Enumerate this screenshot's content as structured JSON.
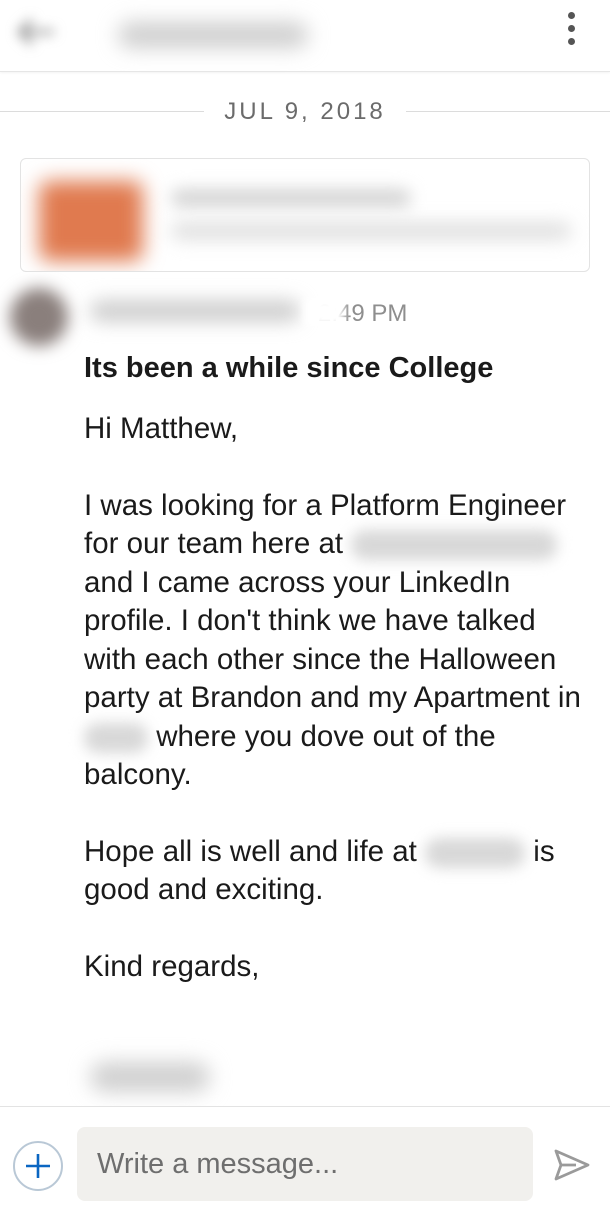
{
  "header": {
    "back_icon": "arrow-left-icon",
    "menu_icon": "more-vert-icon"
  },
  "date_divider": "JUL 9, 2018",
  "message": {
    "time": "2:49 PM",
    "subject": "Its been a while since College",
    "greeting": "Hi Matthew,",
    "body_part1": "I was looking for a Platform Engineer for our team here at",
    "body_part2": "and I came across your LinkedIn profile. I don't think we have talked with each other since the Halloween party at Brandon and my Apartment in",
    "body_part3": "where you dove out of the balcony.",
    "hope_part1": "Hope all is well and life at",
    "hope_part2": "is good and exciting.",
    "closing": "Kind regards,"
  },
  "composer": {
    "placeholder": "Write a message...",
    "add_icon": "plus-icon",
    "send_icon": "send-icon"
  },
  "colors": {
    "accent": "#0a66c2",
    "send_gray": "#9a9a9a",
    "divider": "#dcdcdc"
  }
}
